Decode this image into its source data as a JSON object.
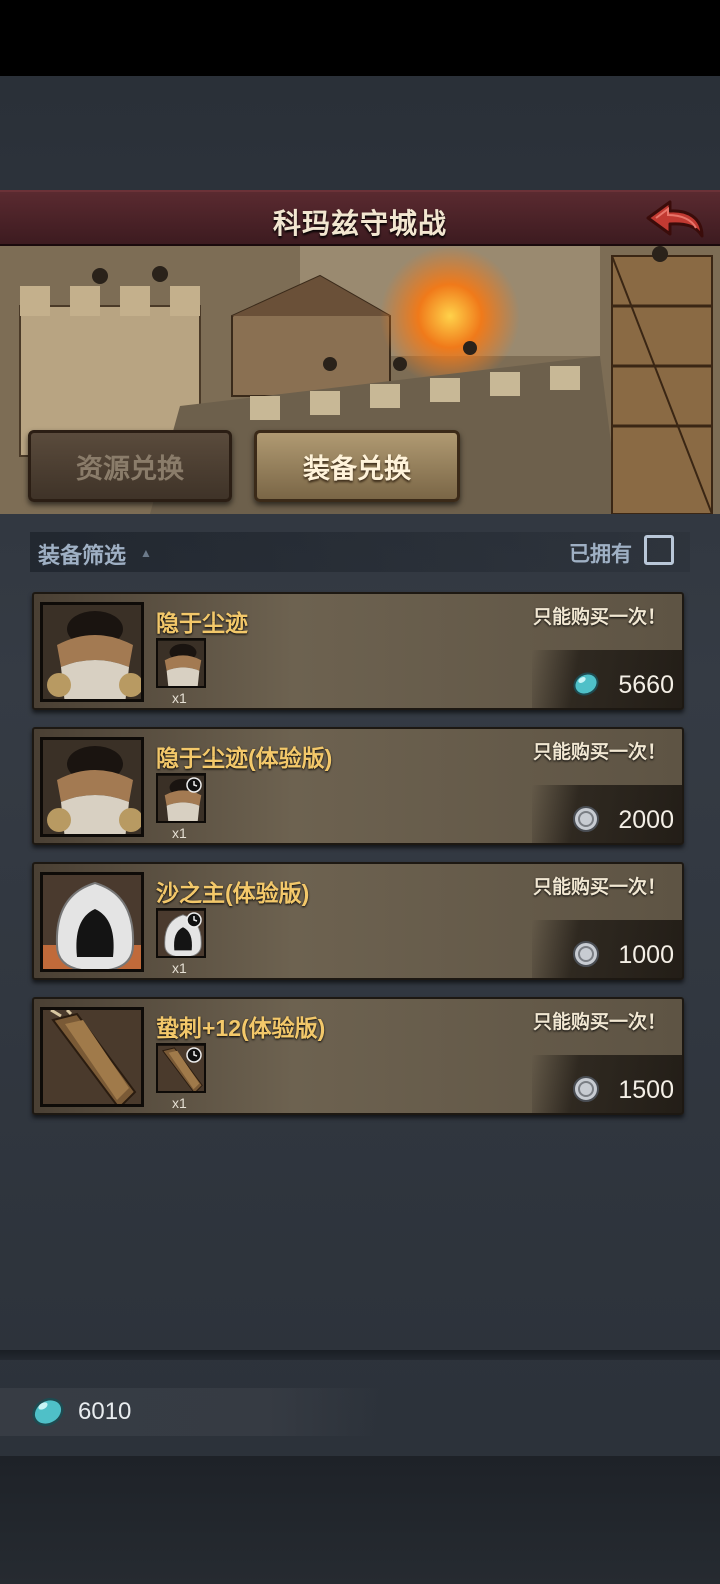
{
  "header": {
    "title": "科玛兹守城战"
  },
  "tabs": [
    {
      "label": "资源兑换",
      "active": false
    },
    {
      "label": "装备兑换",
      "active": true
    }
  ],
  "filter": {
    "label": "装备筛选",
    "owned_label": "已拥有",
    "owned_checked": false
  },
  "items": [
    {
      "name": "隐于尘迹",
      "limit": "只能购买一次！",
      "qty": "x1",
      "price": "5660",
      "currency_icon": "gem-icon",
      "trial": false
    },
    {
      "name": "隐于尘迹(体验版)",
      "limit": "只能购买一次！",
      "qty": "x1",
      "price": "2000",
      "currency_icon": "silver-coin-icon",
      "trial": true
    },
    {
      "name": "沙之主(体验版)",
      "limit": "只能购买一次！",
      "qty": "x1",
      "price": "1000",
      "currency_icon": "silver-coin-icon",
      "trial": true
    },
    {
      "name": "蛰刺+12(体验版)",
      "limit": "只能购买一次！",
      "qty": "x1",
      "price": "1500",
      "currency_icon": "silver-coin-icon",
      "trial": true
    }
  ],
  "balance": {
    "amount": "6010",
    "icon": "gem-icon"
  },
  "colors": {
    "accent_name": "#f3c86a",
    "title_bar": "#4a2228",
    "gem": "#4fc0c8"
  }
}
